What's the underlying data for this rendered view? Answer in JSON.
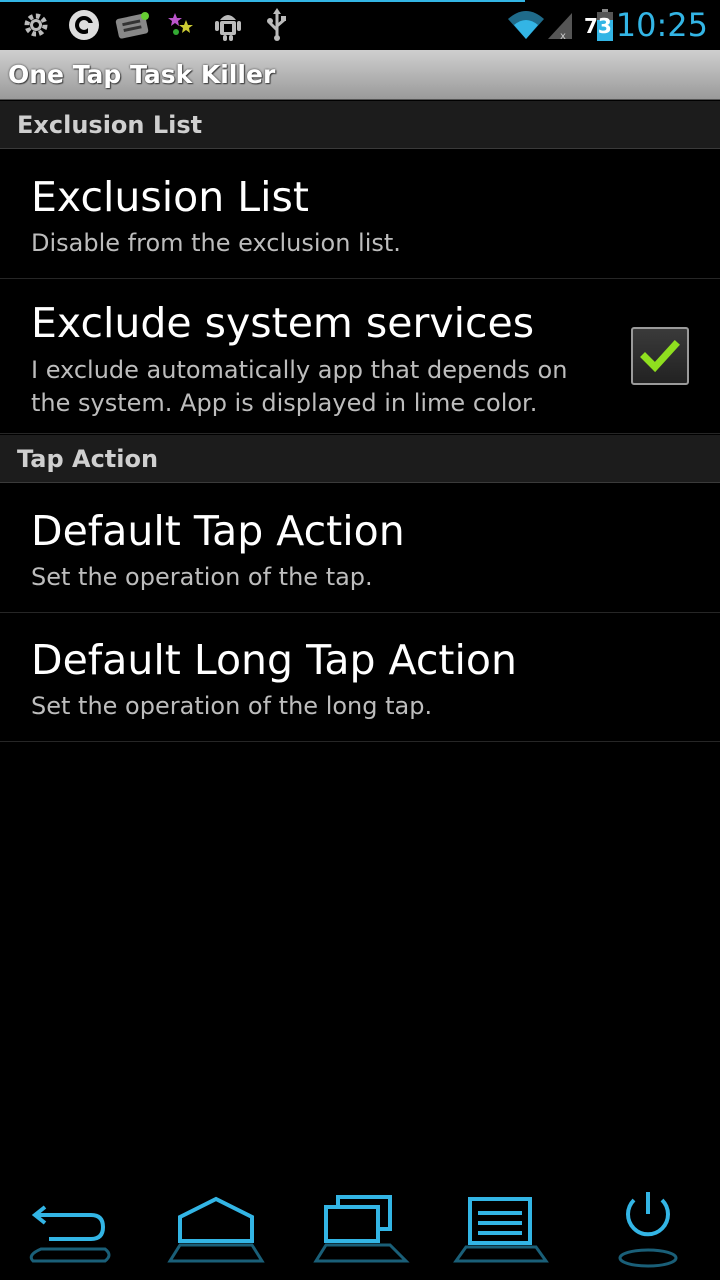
{
  "status_bar": {
    "battery_level": "73",
    "time": "10:25",
    "icons": [
      "settings-icon",
      "avast-icon",
      "keyboard-icon",
      "stars-icon",
      "android-debug-icon",
      "usb-icon",
      "wifi-icon",
      "signal-icon",
      "battery-icon"
    ],
    "accent_color": "#33b5e5"
  },
  "app": {
    "title": "One Tap Task Killer"
  },
  "sections": {
    "exclusion": {
      "header": "Exclusion List",
      "items": [
        {
          "title": "Exclusion List",
          "summary": "Disable from the exclusion list."
        },
        {
          "title": "Exclude system services",
          "summary_line1": "I exclude automatically app that depends on",
          "summary_line2": "the system. App is displayed in lime color.",
          "checked": true
        }
      ]
    },
    "tap_action": {
      "header": "Tap Action",
      "items": [
        {
          "title": "Default Tap Action",
          "summary": "Set the operation of the tap."
        },
        {
          "title": "Default Long Tap Action",
          "summary": "Set the operation of the long tap."
        }
      ]
    }
  },
  "nav_bar": {
    "buttons": [
      "back-icon",
      "home-icon",
      "recent-apps-icon",
      "menu-icon",
      "power-icon"
    ]
  }
}
